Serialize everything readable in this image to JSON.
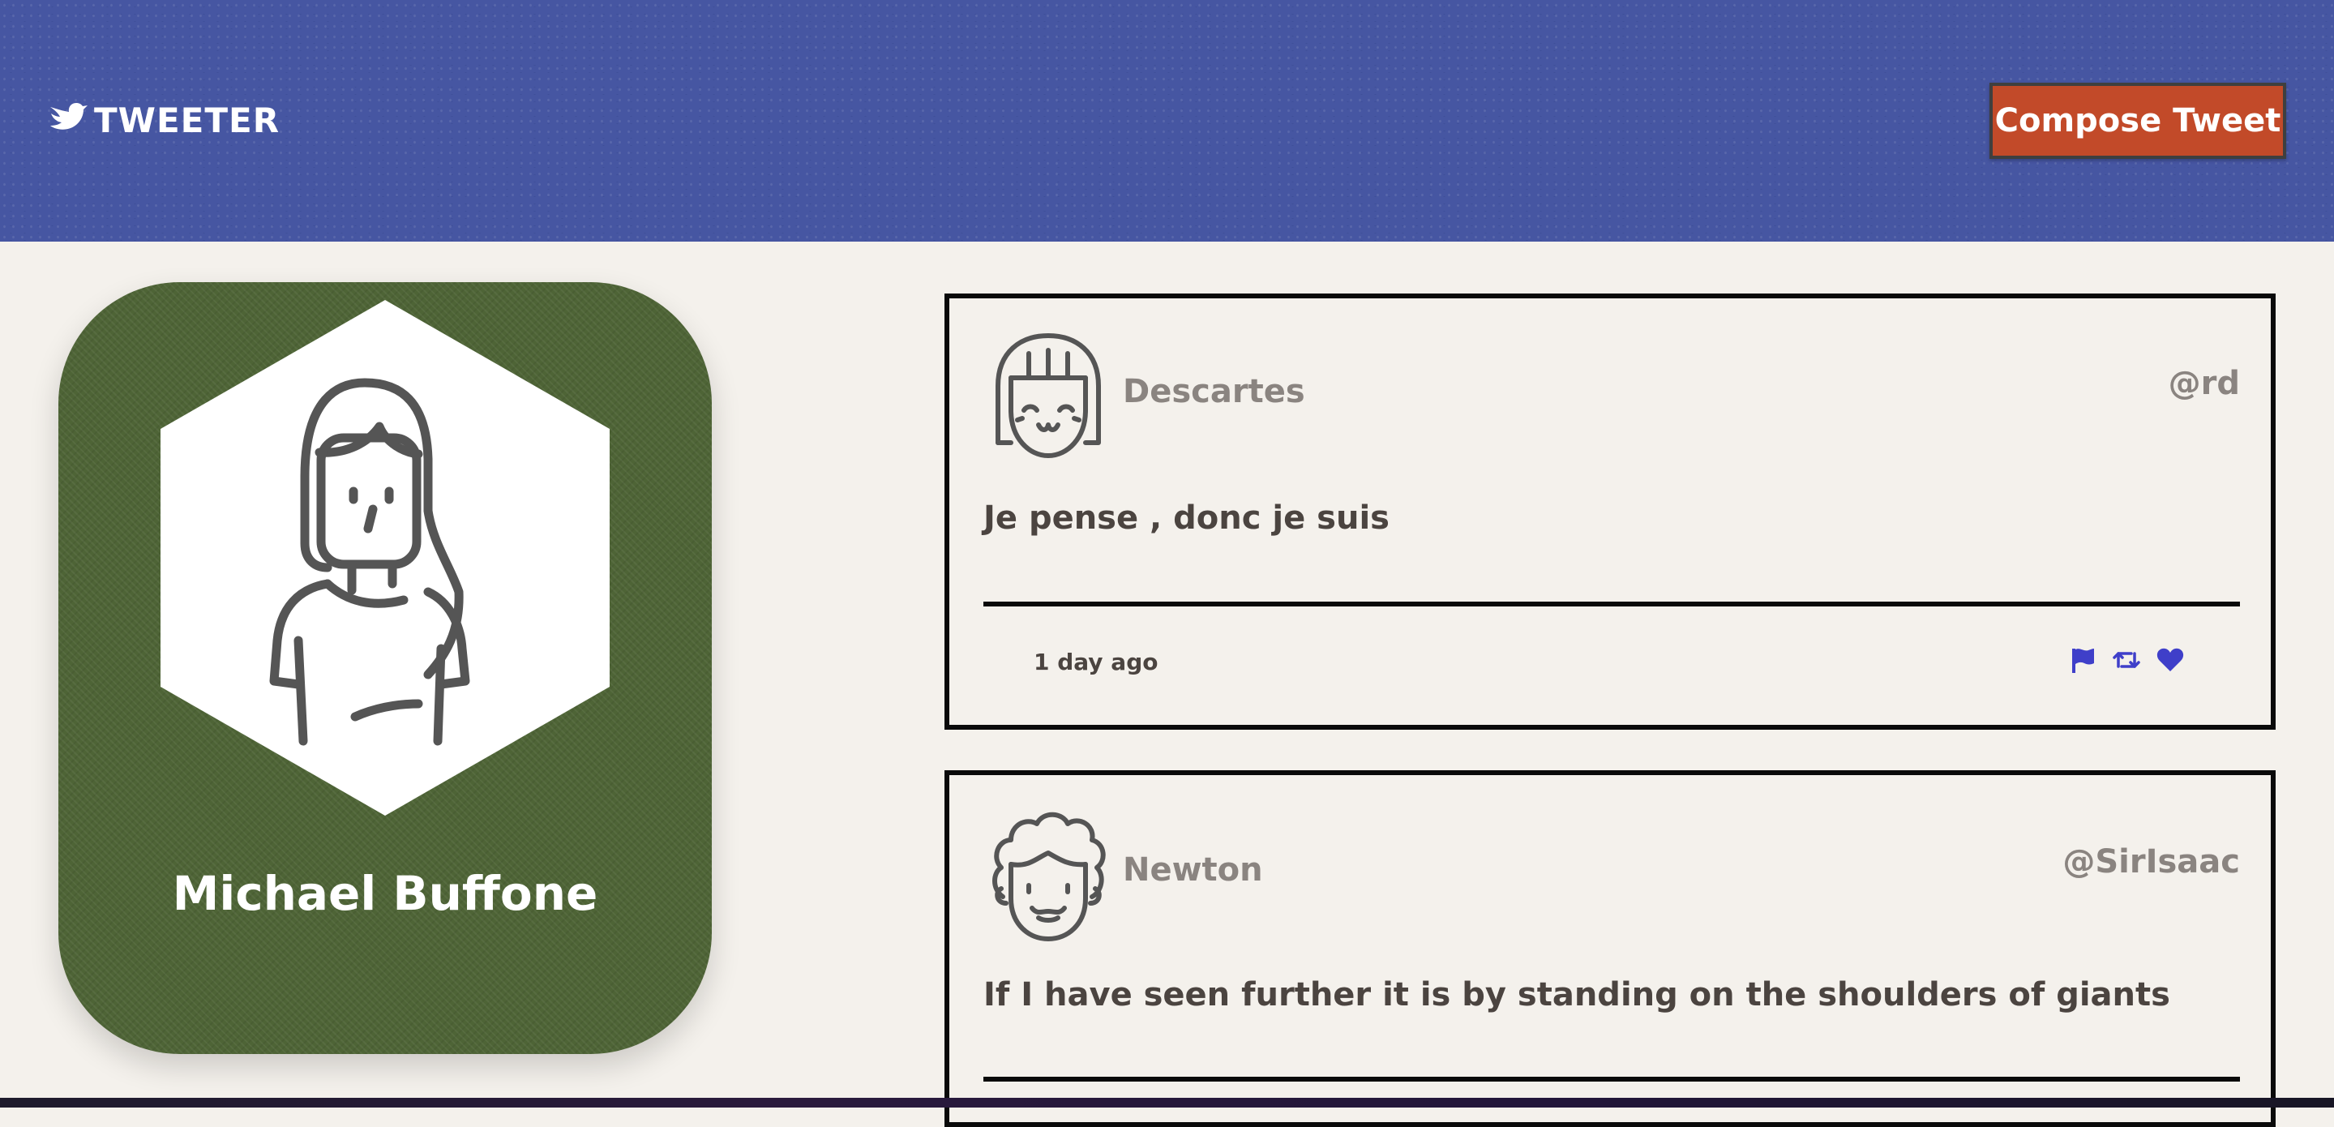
{
  "nav": {
    "brand": "TWEETER",
    "compose_label": "Compose Tweet",
    "bg_color": "#4656a2",
    "compose_color": "#c24a29"
  },
  "profile": {
    "name": "Michael Buffone",
    "bg_color": "#4e6436",
    "avatar_icon": "user-avatar-icon"
  },
  "tweets": [
    {
      "name": "Descartes",
      "handle": "@rd",
      "text": "Je pense , donc je suis",
      "time": "1 day ago",
      "avatar_icon": "girl-avatar-icon",
      "actions": [
        "flag-icon",
        "retweet-icon",
        "heart-icon"
      ]
    },
    {
      "name": "Newton",
      "handle": "@SirIsaac",
      "text": "If I have seen further it is by standing on the shoulders of giants",
      "avatar_icon": "curly-hair-avatar-icon"
    }
  ],
  "colors": {
    "page_bg": "#f4f1ec",
    "action_blue": "#3f3fc9",
    "muted_text": "#8a8480",
    "body_text": "#4b4440"
  }
}
